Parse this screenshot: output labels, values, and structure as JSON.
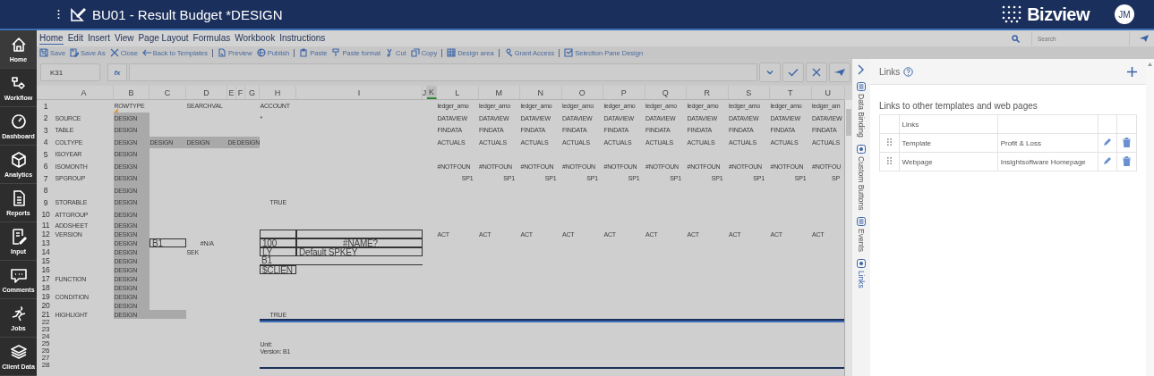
{
  "header": {
    "title": "BU01 - Result Budget *DESIGN",
    "brand": "Bizview",
    "avatar": "JM"
  },
  "nav": [
    {
      "label": "Home",
      "selected": true
    },
    {
      "label": "Workflow",
      "selected": false
    },
    {
      "label": "Dashboard",
      "selected": false
    },
    {
      "label": "Analytics",
      "selected": false
    },
    {
      "label": "Reports",
      "selected": false
    },
    {
      "label": "Input",
      "selected": false
    },
    {
      "label": "Comments",
      "selected": false
    },
    {
      "label": "Jobs",
      "selected": false
    },
    {
      "label": "Client Data",
      "selected": false
    }
  ],
  "menu": [
    {
      "label": "Home",
      "selected": true
    },
    {
      "label": "Edit",
      "selected": false
    },
    {
      "label": "Insert",
      "selected": false
    },
    {
      "label": "View",
      "selected": false
    },
    {
      "label": "Page Layout",
      "selected": false
    },
    {
      "label": "Formulas",
      "selected": false
    },
    {
      "label": "Workbook",
      "selected": false
    },
    {
      "label": "Instructions",
      "selected": false
    }
  ],
  "search": {
    "placeholder": "Search"
  },
  "toolbar": [
    [
      "Save",
      "Save As",
      "Close",
      "Back to Templates"
    ],
    [
      "Preview",
      "Publish"
    ],
    [
      "Paste",
      "Paste format",
      "Cut",
      "Copy"
    ],
    [
      "Design area"
    ],
    [
      "Grant Access"
    ],
    [
      "Selection Pane Design"
    ]
  ],
  "formula_bar": {
    "cell": "K31",
    "fx": "fx"
  },
  "sheet": {
    "columns": [
      {
        "label": "A",
        "selected": false
      },
      {
        "label": "B",
        "selected": false
      },
      {
        "label": "C",
        "selected": false
      },
      {
        "label": "D",
        "selected": false
      },
      {
        "label": "E",
        "selected": false
      },
      {
        "label": "F",
        "selected": false
      },
      {
        "label": "G",
        "selected": false
      },
      {
        "label": "H",
        "selected": false
      },
      {
        "label": "I",
        "selected": false
      },
      {
        "label": "J",
        "selected": false
      },
      {
        "label": "K",
        "selected": true
      },
      {
        "label": "L",
        "selected": false
      },
      {
        "label": "M",
        "selected": false
      },
      {
        "label": "N",
        "selected": false
      },
      {
        "label": "O",
        "selected": false
      },
      {
        "label": "P",
        "selected": false
      },
      {
        "label": "Q",
        "selected": false
      },
      {
        "label": "R",
        "selected": false
      },
      {
        "label": "S",
        "selected": false
      },
      {
        "label": "T",
        "selected": false
      },
      {
        "label": "U",
        "selected": false
      }
    ],
    "rows": [
      {
        "num": "1",
        "cells": [
          null,
          {
            "text": "ROWTYPE",
            "note": true
          },
          null,
          {
            "text": "SEARCHVAL"
          },
          null,
          null,
          null,
          {
            "text": "ACCOUNT"
          },
          null,
          null,
          null,
          {
            "text": "ledger_amo"
          },
          {
            "text": "ledger_amo"
          },
          {
            "text": "ledger_amo"
          },
          {
            "text": "ledger_amo"
          },
          {
            "text": "ledger_amo"
          },
          {
            "text": "ledger_amo"
          },
          {
            "text": "ledger_amo"
          },
          {
            "text": "ledger_amo"
          },
          {
            "text": "ledger_amo"
          },
          {
            "text": "ledger_am"
          }
        ]
      },
      {
        "num": "2",
        "cells": [
          {
            "text": "SOURCE"
          },
          {
            "text": "DESIGN",
            "shaded": true
          },
          null,
          null,
          null,
          null,
          null,
          {
            "text": "*"
          },
          null,
          null,
          null,
          {
            "text": "DATAVIEW"
          },
          {
            "text": "DATAVIEW"
          },
          {
            "text": "DATAVIEW"
          },
          {
            "text": "DATAVIEW"
          },
          {
            "text": "DATAVIEW"
          },
          {
            "text": "DATAVIEW"
          },
          {
            "text": "DATAVIEW"
          },
          {
            "text": "DATAVIEW"
          },
          {
            "text": "DATAVIEW"
          },
          {
            "text": "DATAVIEW"
          }
        ]
      },
      {
        "num": "3",
        "cells": [
          {
            "text": "TABLE"
          },
          {
            "text": "DESIGN",
            "shaded": true
          },
          null,
          null,
          null,
          null,
          null,
          null,
          null,
          null,
          null,
          {
            "text": "FINDATA"
          },
          {
            "text": "FINDATA"
          },
          {
            "text": "FINDATA"
          },
          {
            "text": "FINDATA"
          },
          {
            "text": "FINDATA"
          },
          {
            "text": "FINDATA"
          },
          {
            "text": "FINDATA"
          },
          {
            "text": "FINDATA"
          },
          {
            "text": "FINDATA"
          },
          {
            "text": "FINDATA"
          }
        ]
      },
      {
        "num": "4",
        "cells": [
          {
            "text": "COLTYPE"
          },
          {
            "text": "DESIGN",
            "shaded": true
          },
          {
            "text": "DESIGN",
            "shaded": true
          },
          {
            "text": "DESIGN",
            "shaded": true
          },
          {
            "text": "DE",
            "shaded": true
          },
          {
            "text": "DESIGN",
            "shaded": true
          },
          {
            "shaded": true
          },
          null,
          null,
          null,
          null,
          {
            "text": "ACTUALS"
          },
          {
            "text": "ACTUALS"
          },
          {
            "text": "ACTUALS"
          },
          {
            "text": "ACTUALS"
          },
          {
            "text": "ACTUALS"
          },
          {
            "text": "ACTUALS"
          },
          {
            "text": "ACTUALS"
          },
          {
            "text": "ACTUALS"
          },
          {
            "text": "ACTUALS"
          },
          {
            "text": "ACTUALS"
          }
        ]
      },
      {
        "num": "5",
        "cells": [
          {
            "text": "ISOYEAR"
          },
          {
            "text": "DESIGN",
            "shaded": true
          }
        ]
      },
      {
        "num": "6",
        "cells": [
          {
            "text": "ISOMONTH"
          },
          {
            "text": "DESIGN",
            "shaded": true
          },
          null,
          null,
          null,
          null,
          null,
          null,
          null,
          null,
          null,
          {
            "text": "#NOTFOUN"
          },
          {
            "text": "#NOTFOUN"
          },
          {
            "text": "#NOTFOUN"
          },
          {
            "text": "#NOTFOUN"
          },
          {
            "text": "#NOTFOUN"
          },
          {
            "text": "#NOTFOUN"
          },
          {
            "text": "#NOTFOUN"
          },
          {
            "text": "#NOTFOUN"
          },
          {
            "text": "#NOTFOUN"
          },
          {
            "text": "#NOTFOU"
          }
        ]
      },
      {
        "num": "7",
        "cells": [
          {
            "text": "SPGROUP"
          },
          {
            "text": "DESIGN",
            "shaded": true
          },
          null,
          null,
          null,
          null,
          null,
          null,
          null,
          null,
          null,
          {
            "text": "SP1",
            "kind": "number"
          },
          {
            "text": "SP1",
            "kind": "number"
          },
          {
            "text": "SP1",
            "kind": "number"
          },
          {
            "text": "SP1",
            "kind": "number"
          },
          {
            "text": "SP1",
            "kind": "number"
          },
          {
            "text": "SP1",
            "kind": "number"
          },
          {
            "text": "SP1",
            "kind": "number"
          },
          {
            "text": "SP1",
            "kind": "number"
          },
          {
            "text": "SP1",
            "kind": "number"
          },
          {
            "text": "SP",
            "kind": "number"
          }
        ]
      },
      {
        "num": "8",
        "cells": [
          null,
          {
            "text": "DESIGN",
            "shaded": true
          }
        ]
      },
      {
        "num": "9",
        "cells": [
          {
            "text": "STORABLE"
          },
          {
            "text": "DESIGN",
            "shaded": true
          },
          null,
          null,
          null,
          null,
          null,
          {
            "text": "TRUE",
            "kind": "flag"
          }
        ]
      },
      {
        "num": "10",
        "cells": [
          {
            "text": "ATTGROUP"
          },
          {
            "text": "DESIGN",
            "shaded": true
          }
        ]
      },
      {
        "num": "11",
        "cells": [
          {
            "text": "ADDSHEET"
          },
          {
            "text": "DESIGN",
            "shaded": true
          }
        ]
      },
      {
        "num": "12",
        "cells": [
          {
            "text": "VERSION"
          },
          {
            "text": "DESIGN",
            "shaded": true
          },
          null,
          null,
          null,
          null,
          null,
          {
            "kind": "input"
          },
          {
            "kind": "input"
          },
          null,
          null,
          {
            "text": "ACT"
          },
          {
            "text": "ACT"
          },
          {
            "text": "ACT"
          },
          {
            "text": "ACT"
          },
          {
            "text": "ACT"
          },
          {
            "text": "ACT"
          },
          {
            "text": "ACT"
          },
          {
            "text": "ACT"
          },
          {
            "text": "ACT"
          },
          {
            "text": "ACT"
          }
        ]
      },
      {
        "num": "13",
        "cells": [
          null,
          {
            "text": "DESIGN",
            "shaded": true
          },
          {
            "text": "B1",
            "kind": "input"
          },
          {
            "text": "#N/A",
            "kind": "flag"
          },
          null,
          null,
          null,
          {
            "text": "100",
            "kind": "input"
          },
          {
            "text": "#NAME?",
            "kind": "result"
          }
        ]
      },
      {
        "num": "14",
        "cells": [
          null,
          {
            "text": "DESIGN",
            "shaded": true
          },
          null,
          {
            "text": "SEK"
          },
          null,
          null,
          null,
          {
            "text": "LY",
            "kind": "input"
          },
          {
            "text": "Default SPKEY",
            "kind": "input"
          }
        ]
      },
      {
        "num": "15",
        "cells": [
          null,
          {
            "text": "DESIGN",
            "shaded": true
          },
          null,
          null,
          null,
          null,
          null,
          {
            "text": "B1",
            "kind": "line"
          },
          {
            "kind": "line"
          }
        ]
      },
      {
        "num": "16",
        "cells": [
          null,
          {
            "text": "DESIGN",
            "shaded": true
          },
          null,
          null,
          null,
          null,
          null,
          {
            "text": "$CLIEN",
            "kind": "input"
          }
        ]
      },
      {
        "num": "17",
        "cells": [
          {
            "text": "FUNCTION"
          },
          {
            "text": "DESIGN",
            "shaded": true
          }
        ]
      },
      {
        "num": "18",
        "cells": [
          null,
          {
            "text": "DESIGN",
            "shaded": true
          }
        ]
      },
      {
        "num": "19",
        "cells": [
          {
            "text": "CONDITION"
          },
          {
            "text": "DESIGN",
            "shaded": true
          }
        ]
      },
      {
        "num": "20",
        "cells": [
          null,
          {
            "text": "DESIGN",
            "shaded": true
          }
        ]
      },
      {
        "num": "21",
        "cells": [
          {
            "text": "HIGHLIGHT"
          },
          {
            "text": "DESIGN",
            "shaded": true
          },
          {
            "shaded": true
          },
          null,
          null,
          null,
          null,
          {
            "text": "TRUE",
            "kind": "flag"
          }
        ]
      },
      {
        "num": "22",
        "rule_top": true
      },
      {
        "num": "23"
      },
      {
        "num": "24"
      },
      {
        "num": "25",
        "cells": [
          null,
          null,
          null,
          null,
          null,
          null,
          null,
          {
            "text": "Unit:"
          }
        ]
      },
      {
        "num": "26",
        "cells": [
          null,
          null,
          null,
          null,
          null,
          null,
          null,
          {
            "text": "Version: B1"
          }
        ]
      },
      {
        "num": "27"
      },
      {
        "num": "28",
        "rule_bottom": true
      }
    ]
  },
  "side_tabs": [
    {
      "label": "Data Binding",
      "selected": false
    },
    {
      "label": "Custom Buttons",
      "selected": false
    },
    {
      "label": "Events",
      "selected": false
    },
    {
      "label": "Links",
      "selected": true
    }
  ],
  "links_panel": {
    "title": "Links",
    "subtitle": "Links to other templates and web pages",
    "column": "Links",
    "rows": [
      {
        "type": "Template",
        "target": "Profit & Loss"
      },
      {
        "type": "Webpage",
        "target": "Insightsoftware Homepage"
      }
    ]
  }
}
